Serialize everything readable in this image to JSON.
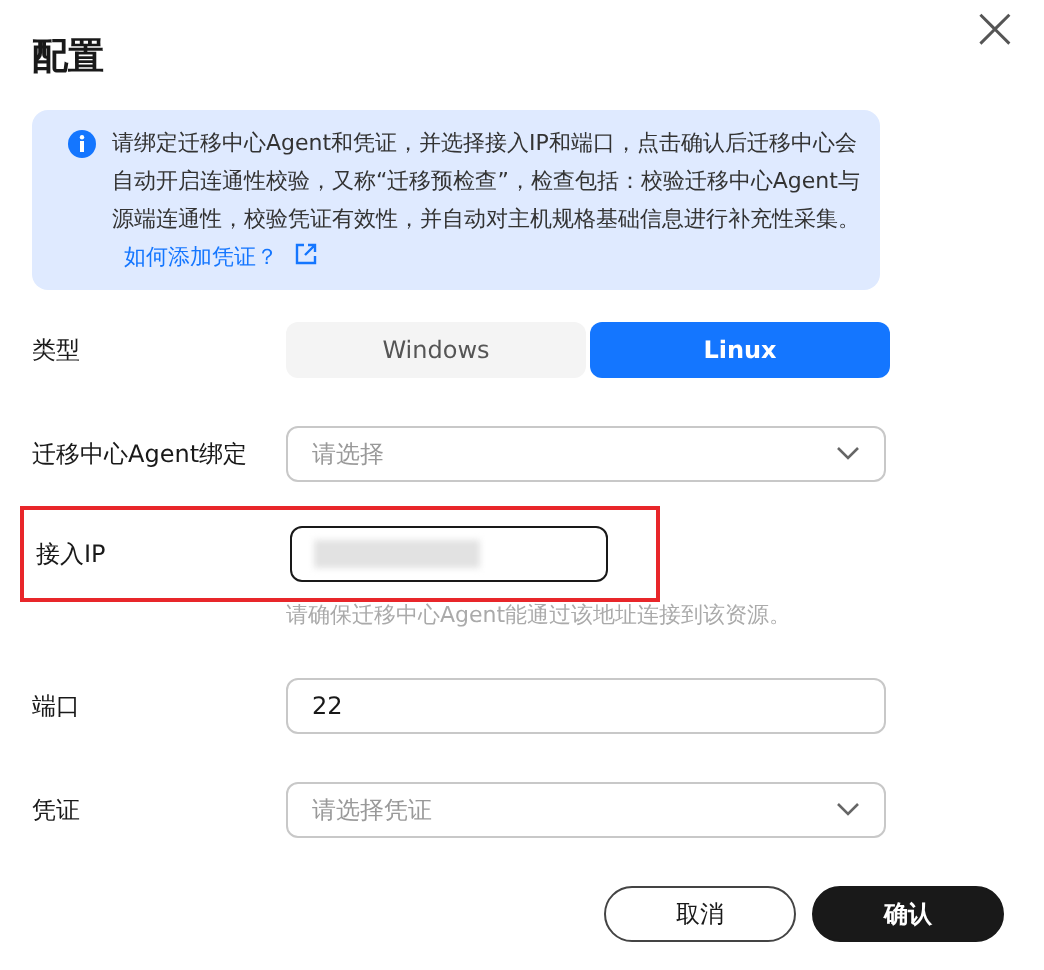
{
  "dialog": {
    "title": "配置",
    "close": "×"
  },
  "notice": {
    "text": "请绑定迁移中心Agent和凭证，并选择接入IP和端口，点击确认后迁移中心会自动开启连通性校验，又称“迁移预检查”，检查包括：校验迁移中心Agent与源端连通性，校验凭证有效性，并自动对主机规格基础信息进行补充性采集。",
    "link": "如何添加凭证？"
  },
  "fields": [
    {
      "kind": "toggle",
      "label": "类型",
      "options": [
        {
          "label": "Windows",
          "selected": false
        },
        {
          "label": "Linux",
          "selected": true
        }
      ]
    },
    {
      "kind": "select",
      "label": "迁移中心Agent绑定",
      "placeholder": "请选择"
    },
    {
      "kind": "redacted",
      "label": "接入IP",
      "hint": "请确保迁移中心Agent能通过该地址连接到该资源。",
      "highlighted": true
    },
    {
      "kind": "input",
      "label": "端口",
      "value": "22"
    },
    {
      "kind": "select",
      "label": "凭证",
      "placeholder": "请选择凭证"
    }
  ],
  "buttons": [
    {
      "label": "取消",
      "primary": false
    },
    {
      "label": "确认",
      "primary": true
    }
  ]
}
